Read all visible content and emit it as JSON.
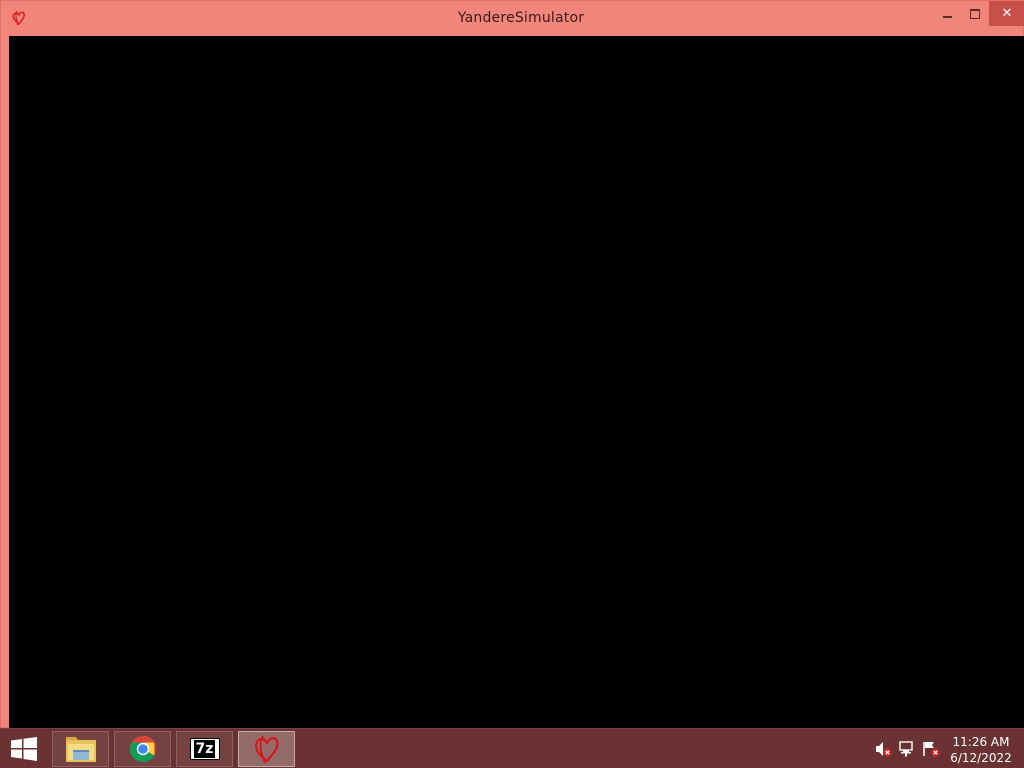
{
  "window": {
    "title": "YandereSimulator",
    "icon": "yandere-heart-icon",
    "minimize_icon": "minimize-icon",
    "maximize_icon": "maximize-icon",
    "close_icon": "close-icon",
    "close_glyph": "✕",
    "frame_color": "#f2857a",
    "close_color": "#c8504a",
    "client_color": "#000000"
  },
  "taskbar": {
    "color": "#6a3232",
    "start_icon": "windows-start-icon",
    "pinned": [
      {
        "name": "file-explorer",
        "icon": "folder-icon"
      },
      {
        "name": "google-chrome",
        "icon": "chrome-icon"
      },
      {
        "name": "7-zip",
        "icon": "7zip-icon",
        "label": "7z"
      },
      {
        "name": "yandere-simulator",
        "icon": "yandere-heart-icon",
        "active": true
      }
    ],
    "tray": {
      "icons": [
        "speaker-muted-icon",
        "network-error-icon",
        "action-center-flag-icon"
      ],
      "time": "11:26 AM",
      "date": "6/12/2022"
    }
  }
}
